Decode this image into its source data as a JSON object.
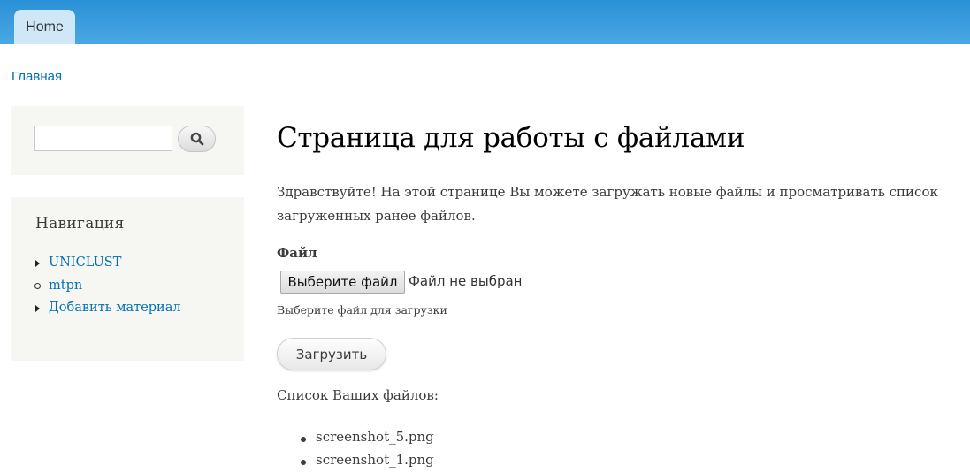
{
  "header": {
    "tab_home": "Home"
  },
  "breadcrumb": {
    "home_link": "Главная"
  },
  "search": {
    "value": "",
    "button_icon": "search-icon"
  },
  "navigation": {
    "title": "Навигация",
    "items": [
      {
        "label": "UNICLUST",
        "bullet": "collapsed-triangle"
      },
      {
        "label": "mtpn",
        "bullet": "leaf-circle"
      },
      {
        "label": "Добавить материал",
        "bullet": "collapsed-triangle"
      }
    ]
  },
  "main": {
    "title": "Страница для работы с файлами",
    "intro": "Здравствуйте! На этой странице Вы можете загружать новые файлы и просматривать список загруженных ранее файлов.",
    "file_field": {
      "label": "Файл",
      "choose_button": "Выберите файл",
      "status": "Файл не выбран",
      "hint": "Выберите файл для загрузки"
    },
    "upload_button": "Загрузить",
    "files_heading": "Список Ваших файлов:",
    "files": [
      "screenshot_5.png",
      "screenshot_1.png"
    ]
  },
  "colors": {
    "header_top": "#2a90d6",
    "header_bottom": "#4aa8e4",
    "link": "#0071b3",
    "sidebar_bg": "#f6f6f2",
    "tab_bg": "#cfe7f6"
  }
}
